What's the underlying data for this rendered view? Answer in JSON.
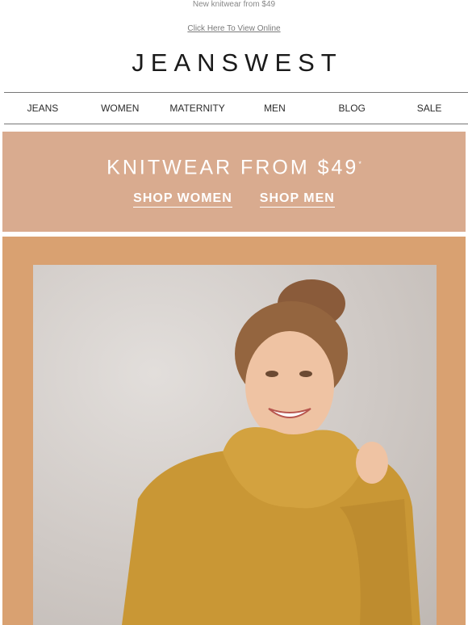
{
  "preheader": "New knitwear from $49",
  "view_online": "Click Here To View Online",
  "logo": "JEANSWEST",
  "nav": [
    {
      "label": "JEANS"
    },
    {
      "label": "WOMEN"
    },
    {
      "label": "MATERNITY"
    },
    {
      "label": "MEN"
    },
    {
      "label": "BLOG"
    },
    {
      "label": "SALE"
    }
  ],
  "promo": {
    "title": "KNITWEAR FROM $49",
    "title_mark": "*",
    "shop_women": "SHOP WOMEN",
    "shop_men": "SHOP MEN",
    "bg_color": "#d9ab8f"
  },
  "hero": {
    "frame_color": "#d9a171",
    "image": "woman in mustard cowl-neck knit sweater"
  }
}
